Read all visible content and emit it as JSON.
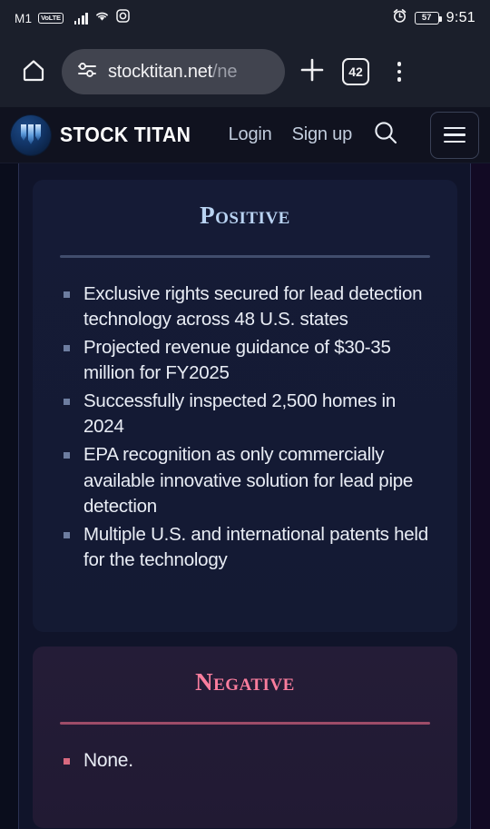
{
  "status_bar": {
    "carrier": "M1",
    "volte_badge": "VoLTE",
    "battery_percent": "57",
    "time": "9:51"
  },
  "browser": {
    "url_main": "stocktitan.net",
    "url_path": "/ne",
    "tab_count": "42"
  },
  "site_header": {
    "brand": "STOCK TITAN",
    "login_label": "Login",
    "signup_label": "Sign up"
  },
  "main": {
    "positive": {
      "title": "Positive",
      "accent_color": "#b9d3f2",
      "items": [
        "Exclusive rights secured for lead detection technology across 48 U.S. states",
        "Projected revenue guidance of $30-35 million for FY2025",
        "Successfully inspected 2,500 homes in 2024",
        "EPA recognition as only commercially available innovative solution for lead pipe detection",
        "Multiple U.S. and international patents held for the technology"
      ]
    },
    "negative": {
      "title": "Negative",
      "accent_color": "#f97d9d",
      "items": [
        "None."
      ]
    }
  }
}
